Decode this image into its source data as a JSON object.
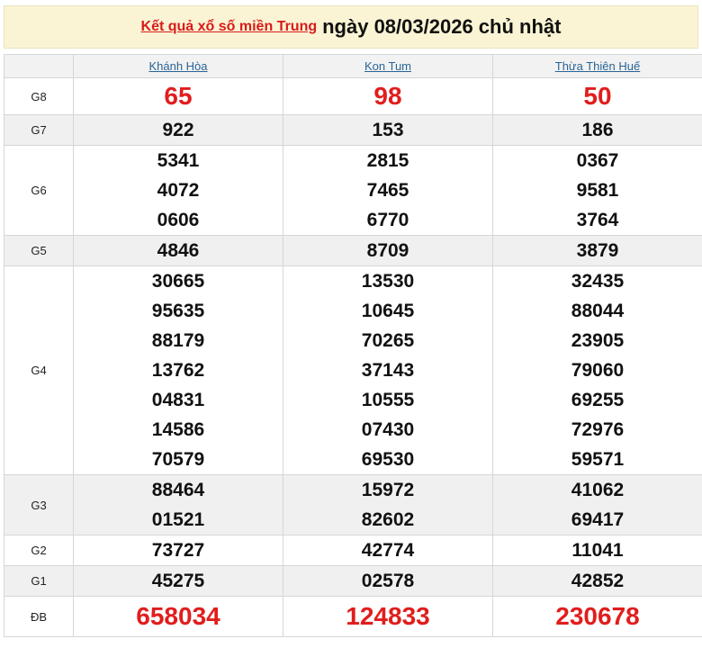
{
  "header": {
    "link_text": "Kết quả xổ số miền Trung",
    "date_text": "ngày 08/03/2026 chủ nhật"
  },
  "provinces": [
    "Khánh Hòa",
    "Kon Tum",
    "Thừa Thiên Huế"
  ],
  "prizes": [
    {
      "label": "G8",
      "numbers": [
        [
          "65"
        ],
        [
          "98"
        ],
        [
          "50"
        ]
      ]
    },
    {
      "label": "G7",
      "numbers": [
        [
          "922"
        ],
        [
          "153"
        ],
        [
          "186"
        ]
      ]
    },
    {
      "label": "G6",
      "numbers": [
        [
          "5341",
          "4072",
          "0606"
        ],
        [
          "2815",
          "7465",
          "6770"
        ],
        [
          "0367",
          "9581",
          "3764"
        ]
      ]
    },
    {
      "label": "G5",
      "numbers": [
        [
          "4846"
        ],
        [
          "8709"
        ],
        [
          "3879"
        ]
      ]
    },
    {
      "label": "G4",
      "numbers": [
        [
          "30665",
          "95635",
          "88179",
          "13762",
          "04831",
          "14586",
          "70579"
        ],
        [
          "13530",
          "10645",
          "70265",
          "37143",
          "10555",
          "07430",
          "69530"
        ],
        [
          "32435",
          "88044",
          "23905",
          "79060",
          "69255",
          "72976",
          "59571"
        ]
      ]
    },
    {
      "label": "G3",
      "numbers": [
        [
          "88464",
          "01521"
        ],
        [
          "15972",
          "82602"
        ],
        [
          "41062",
          "69417"
        ]
      ]
    },
    {
      "label": "G2",
      "numbers": [
        [
          "73727"
        ],
        [
          "42774"
        ],
        [
          "11041"
        ]
      ]
    },
    {
      "label": "G1",
      "numbers": [
        [
          "45275"
        ],
        [
          "02578"
        ],
        [
          "42852"
        ]
      ]
    },
    {
      "label": "ĐB",
      "numbers": [
        [
          "658034"
        ],
        [
          "124833"
        ],
        [
          "230678"
        ]
      ]
    }
  ]
}
